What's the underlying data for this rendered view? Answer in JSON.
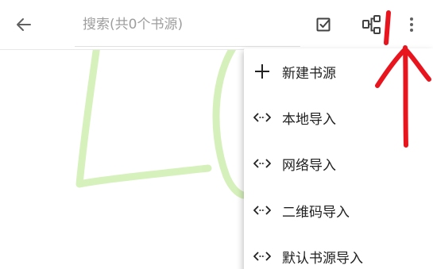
{
  "toolbar": {
    "search_placeholder": "搜索(共0个书源)"
  },
  "menu": {
    "items": [
      {
        "label": "新建书源",
        "icon": "plus-icon"
      },
      {
        "label": "本地导入",
        "icon": "import-icon"
      },
      {
        "label": "网络导入",
        "icon": "import-icon"
      },
      {
        "label": "二维码导入",
        "icon": "import-icon"
      },
      {
        "label": "默认书源导入",
        "icon": "import-icon"
      }
    ]
  },
  "colors": {
    "icon": "#616161",
    "annotation_red": "#e8141e",
    "watermark_green": "#c8eaa0"
  }
}
